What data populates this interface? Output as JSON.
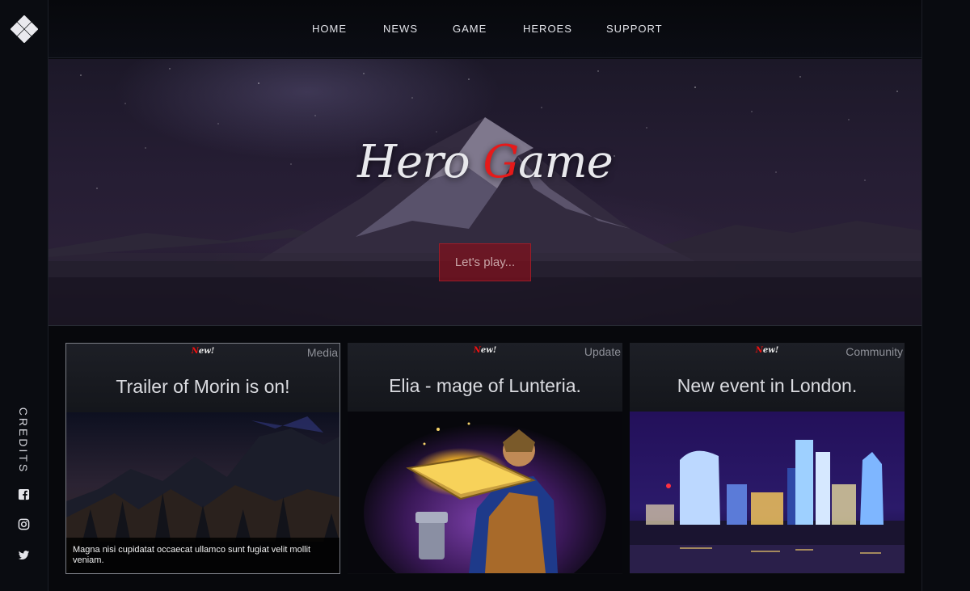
{
  "nav": {
    "items": [
      {
        "label": "HOME"
      },
      {
        "label": "NEWS"
      },
      {
        "label": "GAME"
      },
      {
        "label": "HEROES"
      },
      {
        "label": "SUPPORT"
      }
    ]
  },
  "sidebar": {
    "logo_icon": "gamepad-cross-icon",
    "credits_label": "CREDITS",
    "social": [
      {
        "icon": "facebook-icon"
      },
      {
        "icon": "instagram-icon"
      },
      {
        "icon": "twitter-icon"
      }
    ]
  },
  "hero": {
    "title_part1": "Hero ",
    "title_accent": "G",
    "title_part2": "ame",
    "cta_label": "Let's play..."
  },
  "cards": [
    {
      "badge_accent": "N",
      "badge_rest": "ew!",
      "category": "Media",
      "title": "Trailer of Morin is on!",
      "caption": "Magna nisi cupidatat occaecat ullamco sunt fugiat velit mollit veniam."
    },
    {
      "badge_accent": "N",
      "badge_rest": "ew!",
      "category": "Update",
      "title": "Elia - mage of Lunteria."
    },
    {
      "badge_accent": "N",
      "badge_rest": "ew!",
      "category": "Community",
      "title": "New event in London."
    }
  ],
  "colors": {
    "accent_red": "#e51a1a",
    "background": "#07080c",
    "cta_fill": "#7d121e"
  }
}
